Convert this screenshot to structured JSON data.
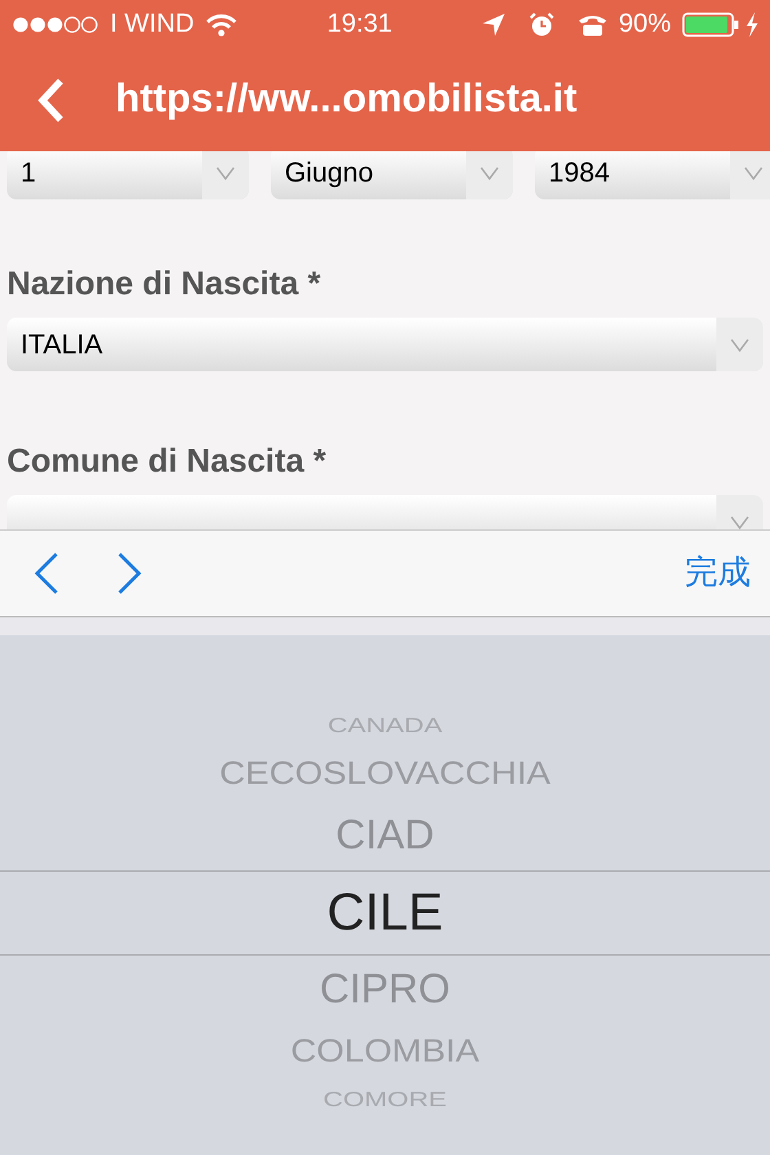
{
  "status_bar": {
    "carrier": "I WIND",
    "time": "19:31",
    "battery": "90%"
  },
  "nav": {
    "title": "https://ww...omobilista.it"
  },
  "date_selects": [
    {
      "value": "1"
    },
    {
      "value": "Giugno"
    },
    {
      "value": "1984"
    }
  ],
  "fields": [
    {
      "label": "Nazione di Nascita *",
      "value": "ITALIA"
    },
    {
      "label": "Comune di Nascita *"
    }
  ],
  "toolbar": {
    "done": "完成"
  },
  "picker": [
    {
      "label": "CANADA",
      "selected": false
    },
    {
      "label": "CECOSLOVACCHIA",
      "selected": false
    },
    {
      "label": "CIAD",
      "selected": false
    },
    {
      "label": "CILE",
      "selected": true
    },
    {
      "label": "CIPRO",
      "selected": false
    },
    {
      "label": "COLOMBIA",
      "selected": false
    },
    {
      "label": "COMORE",
      "selected": false
    }
  ]
}
